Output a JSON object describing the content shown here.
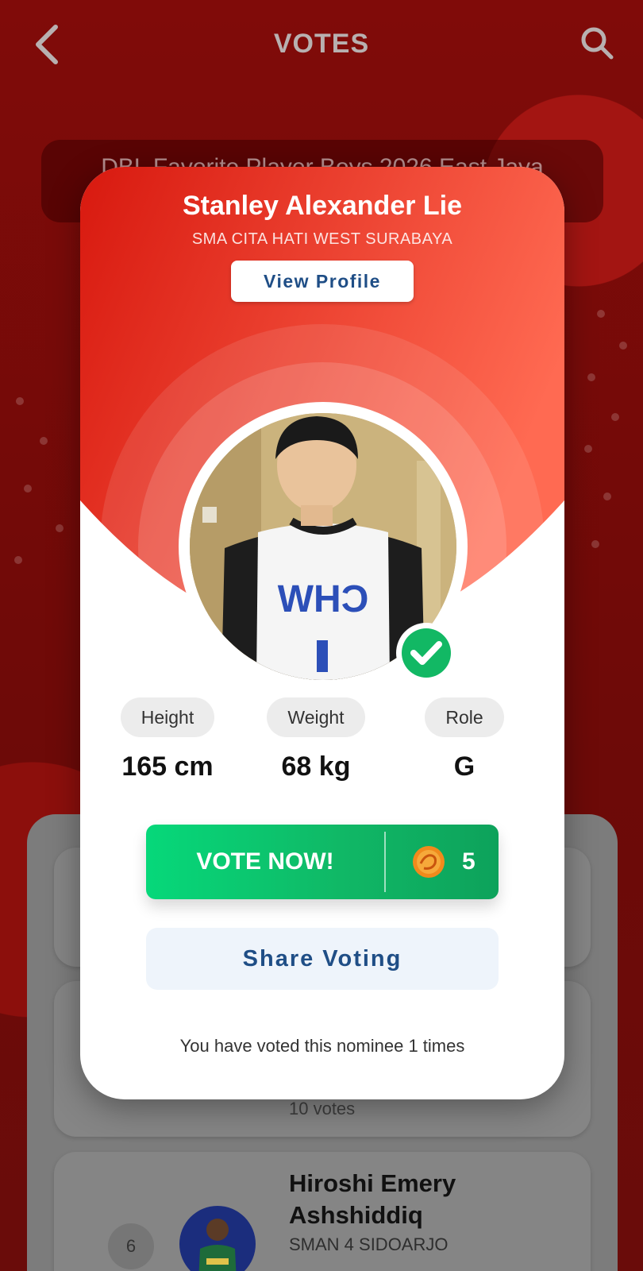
{
  "header": {
    "title": "VOTES",
    "back_icon": "chevron-left-icon",
    "search_icon": "search-icon"
  },
  "category": {
    "label": "DBL Favorite Player Boys 2026 East Java"
  },
  "background_list": {
    "partial_votes": "10 votes",
    "items": [
      {
        "rank": "6",
        "name": "Hiroshi Emery Ashshiddiq",
        "school": "SMAN 4 SIDOARJO"
      }
    ]
  },
  "modal": {
    "name": "Stanley Alexander Lie",
    "school": "SMA CITA HATI WEST SURABAYA",
    "view_profile_label": "View Profile",
    "verified_icon": "check-circle-icon",
    "stats": [
      {
        "label": "Height",
        "value": "165 cm"
      },
      {
        "label": "Weight",
        "value": "68 kg"
      },
      {
        "label": "Role",
        "value": "G"
      }
    ],
    "vote_button_label": "VOTE NOW!",
    "vote_cost": "5",
    "coin_icon": "coin-icon",
    "share_label": "Share Voting",
    "vote_count_note": "You have voted this nominee 1 times"
  },
  "colors": {
    "header_red": "#e8271c",
    "vote_green": "#10b866",
    "link_blue": "#1f4e86"
  }
}
